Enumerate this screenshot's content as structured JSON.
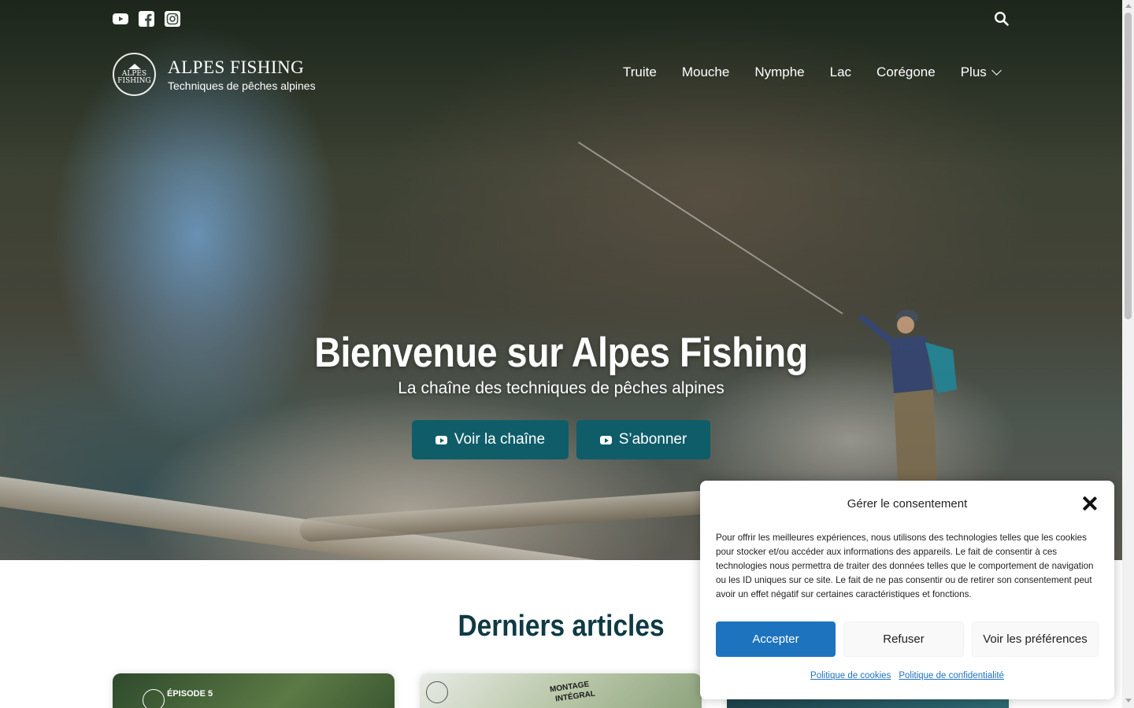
{
  "social": {
    "icons": [
      "youtube-icon",
      "facebook-icon",
      "instagram-icon"
    ]
  },
  "brand": {
    "logo_line1": "ALPES",
    "logo_line2": "FISHING",
    "name": "ALPES FISHING",
    "tagline": "Techniques de pêches alpines"
  },
  "nav": {
    "items": [
      "Truite",
      "Mouche",
      "Nymphe",
      "Lac",
      "Corégone",
      "Plus"
    ]
  },
  "hero": {
    "title": "Bienvenue sur Alpes Fishing",
    "subtitle": "La chaîne des techniques de pêches alpines",
    "button_channel": "Voir la chaîne",
    "button_subscribe": "S’abonner"
  },
  "articles": {
    "title": "Derniers articles",
    "card1_label": "ÉPISODE 5",
    "card2_label_line1": "MONTAGE",
    "card2_label_line2": "INTÉGRAL"
  },
  "consent": {
    "title": "Gérer le consentement",
    "body": "Pour offrir les meilleures expériences, nous utilisons des technologies telles que les cookies pour stocker et/ou accéder aux informations des appareils. Le fait de consentir à ces technologies nous permettra de traiter des données telles que le comportement de navigation ou les ID uniques sur ce site. Le fait de ne pas consentir ou de retirer son consentement peut avoir un effet négatif sur certaines caractéristiques et fonctions.",
    "accept": "Accepter",
    "refuse": "Refuser",
    "preferences": "Voir les préférences",
    "cookie_policy": "Politique de cookies",
    "privacy_policy": "Politique de confidentialité"
  },
  "colors": {
    "primary_button": "#0f5d69",
    "accept_button": "#1e73be",
    "heading": "#0f3a44"
  }
}
